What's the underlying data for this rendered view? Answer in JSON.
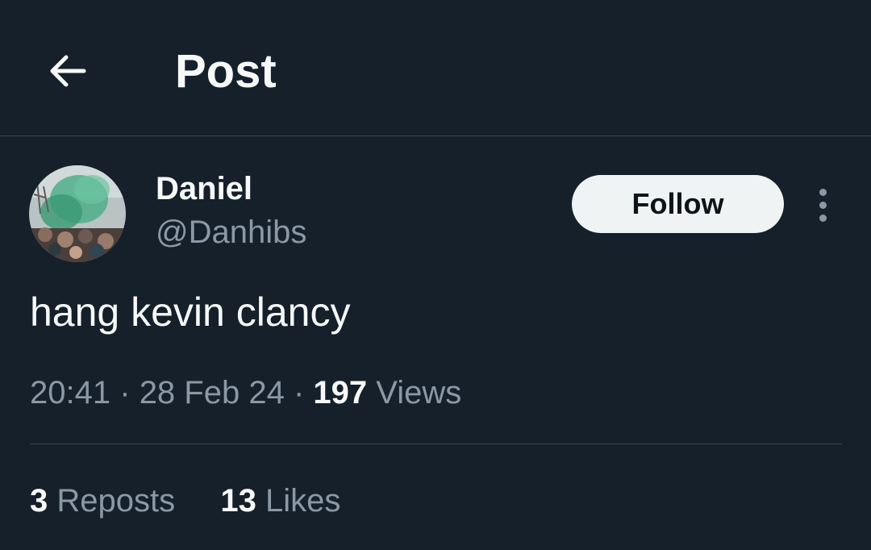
{
  "header": {
    "back_icon": "arrow-left-icon",
    "title": "Post"
  },
  "author": {
    "avatar": "avatar-photo-green-smoke-crowd",
    "display_name": "Daniel",
    "handle": "@Danhibs",
    "follow_label": "Follow",
    "more_icon": "more-vertical-icon"
  },
  "post": {
    "text": "hang kevin clancy",
    "time": "20:41",
    "separator": "·",
    "date": "28 Feb 24",
    "views_count": "197",
    "views_label": "Views"
  },
  "stats": {
    "reposts_count": "3",
    "reposts_label": "Reposts",
    "likes_count": "13",
    "likes_label": "Likes"
  },
  "colors": {
    "background": "#15202b",
    "text_primary": "#f7f9f9",
    "text_secondary": "#8b98a5",
    "divider": "#38444d",
    "follow_bg": "#eff3f4"
  }
}
